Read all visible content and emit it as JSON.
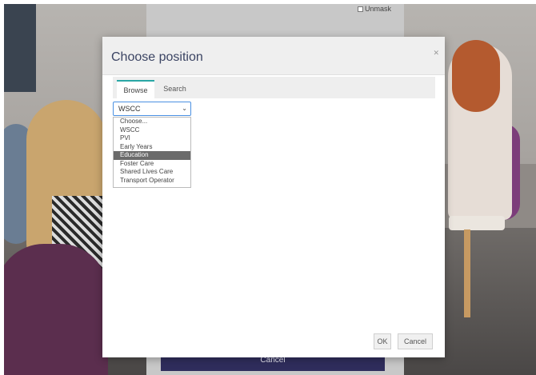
{
  "background": {
    "unmask_label": "Unmask",
    "cancel_label": "Cancel"
  },
  "dialog": {
    "title": "Choose position",
    "close_icon": "close-icon",
    "tabs": [
      {
        "label": "Browse",
        "active": true
      },
      {
        "label": "Search",
        "active": false
      }
    ],
    "select": {
      "value": "WSCC",
      "options": [
        "Choose...",
        "WSCC",
        "PVI",
        "Early Years",
        "Education",
        "Foster Care",
        "Shared Lives Care",
        "Transport Operator"
      ],
      "highlighted": "Education"
    },
    "ok_label": "OK",
    "cancel_label": "Cancel"
  },
  "colors": {
    "accent": "#2aa7a5",
    "title": "#3b4463",
    "highlight": "#6b6b6b",
    "behind_button": "#2f2d5c"
  }
}
